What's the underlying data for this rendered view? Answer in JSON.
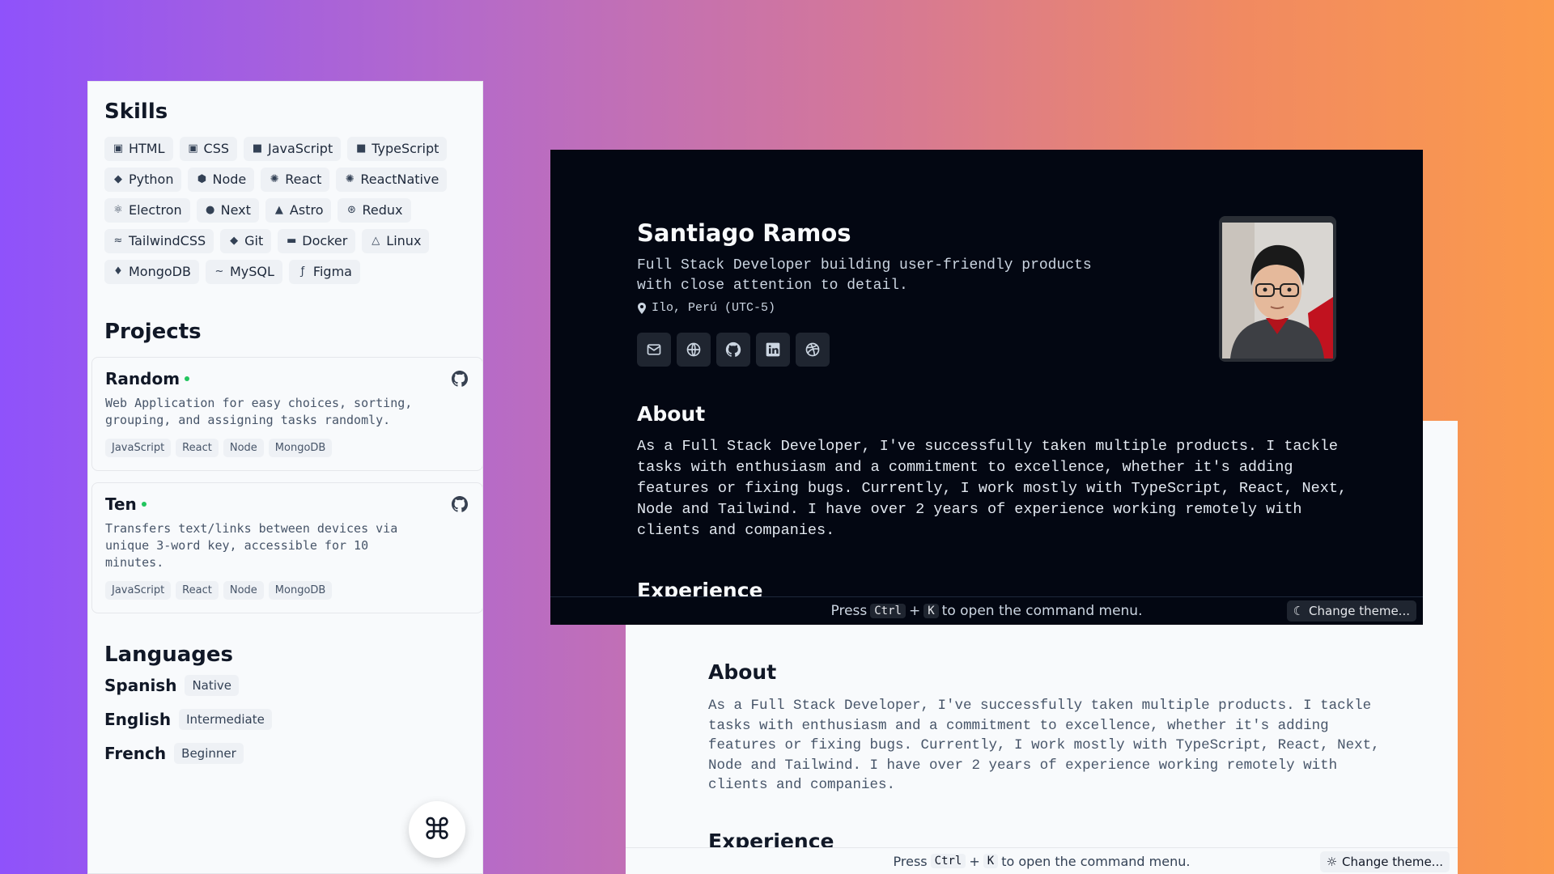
{
  "skills": {
    "title": "Skills",
    "items": [
      {
        "label": "HTML",
        "icon": "html5-icon"
      },
      {
        "label": "CSS",
        "icon": "css3-icon"
      },
      {
        "label": "JavaScript",
        "icon": "javascript-icon"
      },
      {
        "label": "TypeScript",
        "icon": "typescript-icon"
      },
      {
        "label": "Python",
        "icon": "python-icon"
      },
      {
        "label": "Node",
        "icon": "nodejs-icon"
      },
      {
        "label": "React",
        "icon": "react-icon"
      },
      {
        "label": "ReactNative",
        "icon": "react-icon"
      },
      {
        "label": "Electron",
        "icon": "electron-icon"
      },
      {
        "label": "Next",
        "icon": "nextjs-icon"
      },
      {
        "label": "Astro",
        "icon": "astro-icon"
      },
      {
        "label": "Redux",
        "icon": "redux-icon"
      },
      {
        "label": "TailwindCSS",
        "icon": "tailwind-icon"
      },
      {
        "label": "Git",
        "icon": "git-icon"
      },
      {
        "label": "Docker",
        "icon": "docker-icon"
      },
      {
        "label": "Linux",
        "icon": "linux-icon"
      },
      {
        "label": "MongoDB",
        "icon": "mongodb-icon"
      },
      {
        "label": "MySQL",
        "icon": "mysql-icon"
      },
      {
        "label": "Figma",
        "icon": "figma-icon"
      }
    ]
  },
  "projects": {
    "title": "Projects",
    "items": [
      {
        "name": "Random",
        "desc": "Web Application for easy choices, sorting, grouping, and assigning tasks randomly.",
        "tags": [
          "JavaScript",
          "React",
          "Node",
          "MongoDB"
        ]
      },
      {
        "name": "Ten",
        "desc": "Transfers text/links between devices via unique 3-word key, accessible for 10 minutes.",
        "tags": [
          "JavaScript",
          "React",
          "Node",
          "MongoDB"
        ]
      }
    ]
  },
  "languages": {
    "title": "Languages",
    "items": [
      {
        "name": "Spanish",
        "level": "Native"
      },
      {
        "name": "English",
        "level": "Intermediate"
      },
      {
        "name": "French",
        "level": "Beginner"
      }
    ]
  },
  "command_fab": {
    "glyph": "⌘"
  },
  "profile": {
    "name": "Santiago Ramos",
    "tagline": "Full Stack Developer building user-friendly products with close attention to detail.",
    "location": "Ilo, Perú (UTC-5)",
    "social_icons": [
      "mail-icon",
      "globe-icon",
      "github-icon",
      "linkedin-icon",
      "dribbble-icon"
    ]
  },
  "about": {
    "title": "About",
    "text": "As a Full Stack Developer, I've successfully taken multiple products. I tackle tasks with enthusiasm and a commitment to excellence, whether it's adding features or fixing bugs. Currently, I work mostly with TypeScript, React, Next, Node and Tailwind. I have over 2 years of experience working remotely with clients and companies."
  },
  "experience": {
    "title": "Experience"
  },
  "command_bar": {
    "press": "Press",
    "key1": "Ctrl",
    "plus": "+",
    "key2": "K",
    "suffix": "to open the command menu.",
    "theme_label": "Change theme..."
  },
  "colors": {
    "dark_bg": "#030712",
    "light_bg": "#f8fafc",
    "status_green": "#22c55e",
    "gradient_start": "#8f52fb",
    "gradient_end": "#fb9a4c"
  }
}
